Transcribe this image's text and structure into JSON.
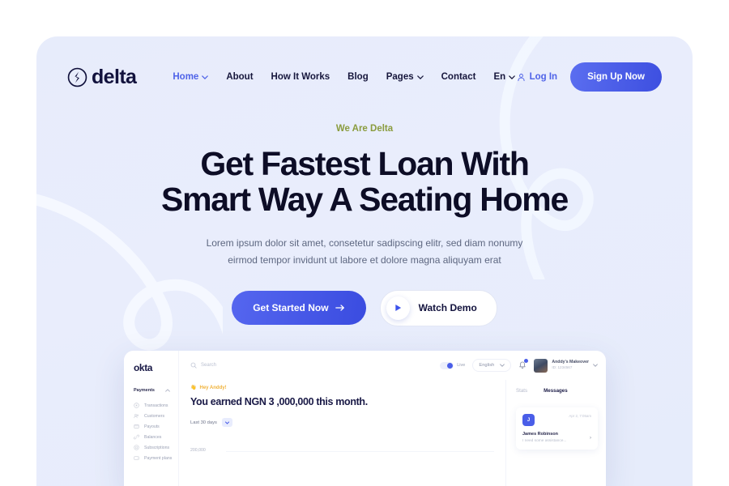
{
  "brand": {
    "name": "delta",
    "mark_icon": "delta-circle-logo"
  },
  "nav": {
    "links": [
      {
        "label": "Home",
        "has_caret": true,
        "active": true
      },
      {
        "label": "About",
        "has_caret": false,
        "active": false
      },
      {
        "label": "How It Works",
        "has_caret": false,
        "active": false
      },
      {
        "label": "Blog",
        "has_caret": false,
        "active": false
      },
      {
        "label": "Pages",
        "has_caret": true,
        "active": false
      },
      {
        "label": "Contact",
        "has_caret": false,
        "active": false
      },
      {
        "label": "En",
        "has_caret": true,
        "active": false
      }
    ],
    "login_label": "Log In",
    "login_icon": "user-icon",
    "signup_label": "Sign Up Now",
    "signup_color": "#4a5ee8"
  },
  "hero": {
    "eyebrow": "We Are Delta",
    "eyebrow_color": "#8a9c3e",
    "title_line1": "Get Fastest Loan With",
    "title_line2": "Smart Way A Seating Home",
    "subtitle_line1": "Lorem ipsum dolor sit amet, consetetur sadipscing elitr, sed diam nonumy",
    "subtitle_line2": "eirmod tempor invidunt ut labore et dolore magna aliquyam erat",
    "primary_cta": "Get Started Now",
    "primary_cta_icon": "arrow-right-icon",
    "secondary_cta": "Watch Demo",
    "secondary_cta_icon": "play-icon"
  },
  "dashboard": {
    "logo": "okta",
    "sidebar": {
      "section_label": "Payments",
      "collapse_icon": "chevron-up-icon",
      "items": [
        {
          "label": "Transactions",
          "icon": "circle-dot-icon"
        },
        {
          "label": "Customers",
          "icon": "people-icon"
        },
        {
          "label": "Payouts",
          "icon": "card-icon"
        },
        {
          "label": "Balances",
          "icon": "link-icon"
        },
        {
          "label": "Subscriptions",
          "icon": "refresh-icon"
        },
        {
          "label": "Payment plans",
          "icon": "wallet-icon"
        }
      ]
    },
    "topbar": {
      "search_placeholder": "Search",
      "search_icon": "search-icon",
      "live_label": "Live",
      "language": "English",
      "bell_icon": "bell-icon",
      "profile_name": "Anddy's Makeover",
      "profile_id": "ID: 1234567"
    },
    "main": {
      "greeting": "Hey Anddy!",
      "greeting_emoji": "👋",
      "earned_text": "You earned NGN 3 ,000,000 this month.",
      "range_label": "Last 30 days",
      "range_caret_icon": "chevron-down-icon"
    },
    "right_panel": {
      "tab_stats": "Stats",
      "tab_messages": "Messages",
      "message": {
        "avatar_initial": "J",
        "time": "Apr 2, 7:05am",
        "name": "James Robinson",
        "preview": "I need some assistance...",
        "arrow_icon": "chevron-right-icon"
      }
    }
  },
  "chart_data": {
    "type": "bar",
    "title": "",
    "categories": [
      "",
      "",
      "",
      "",
      "",
      ""
    ],
    "values": [
      0,
      0,
      0,
      0,
      1,
      0
    ],
    "ytick_labels": [
      "200,000"
    ],
    "xlabel": "",
    "ylabel": "",
    "grid": true,
    "bar_color": "#3d53ec"
  }
}
